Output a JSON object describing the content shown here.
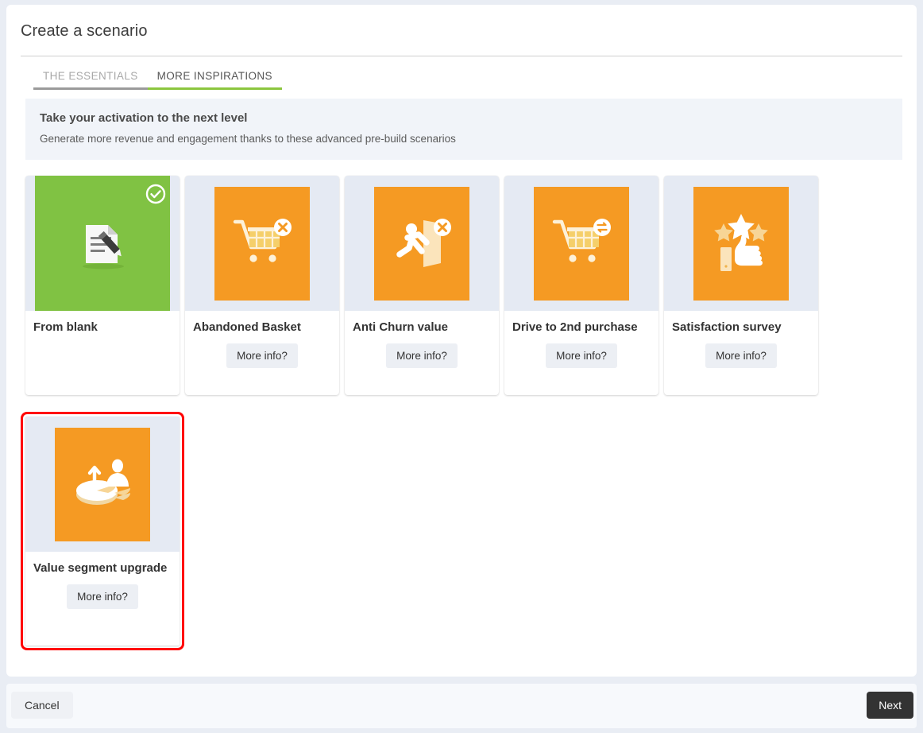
{
  "page": {
    "title": "Create a scenario"
  },
  "tabs": [
    {
      "label": "THE ESSENTIALS",
      "active": false,
      "name": "tab-the-essentials"
    },
    {
      "label": "MORE INSPIRATIONS",
      "active": true,
      "name": "tab-more-inspirations"
    }
  ],
  "banner": {
    "title": "Take your activation to the next level",
    "subtitle": "Generate more revenue and engagement thanks to these advanced pre-build scenarios"
  },
  "cards": [
    {
      "title": "From blank",
      "icon": "document-pencil-icon",
      "thumb_color": "#80c243",
      "selected": true,
      "has_more_info": false,
      "more_info_label": ""
    },
    {
      "title": "Abandoned Basket",
      "icon": "shopping-cart-remove-icon",
      "thumb_color": "#f59a23",
      "selected": false,
      "has_more_info": true,
      "more_info_label": "More info?"
    },
    {
      "title": "Anti Churn value",
      "icon": "person-exit-door-icon",
      "thumb_color": "#f59a23",
      "selected": false,
      "has_more_info": true,
      "more_info_label": "More info?"
    },
    {
      "title": "Drive to 2nd purchase",
      "icon": "shopping-cart-repeat-icon",
      "thumb_color": "#f59a23",
      "selected": false,
      "has_more_info": true,
      "more_info_label": "More info?"
    },
    {
      "title": "Satisfaction survey",
      "icon": "thumbs-up-stars-icon",
      "thumb_color": "#f59a23",
      "selected": false,
      "has_more_info": true,
      "more_info_label": "More info?"
    }
  ],
  "cards_row2": [
    {
      "title": "Value segment upgrade",
      "icon": "pie-chart-person-upgrade-icon",
      "thumb_color": "#f59a23",
      "selected": false,
      "highlighted": true,
      "has_more_info": true,
      "more_info_label": "More info?"
    }
  ],
  "footer": {
    "cancel_label": "Cancel",
    "next_label": "Next"
  },
  "colors": {
    "accent_green": "#8cc63f",
    "thumb_orange": "#f59a23",
    "thumb_green": "#80c243",
    "highlight_red": "#ff0000",
    "panel_bg": "#ffffff",
    "page_bg": "#e9edf4",
    "banner_bg": "#f1f4f9"
  }
}
